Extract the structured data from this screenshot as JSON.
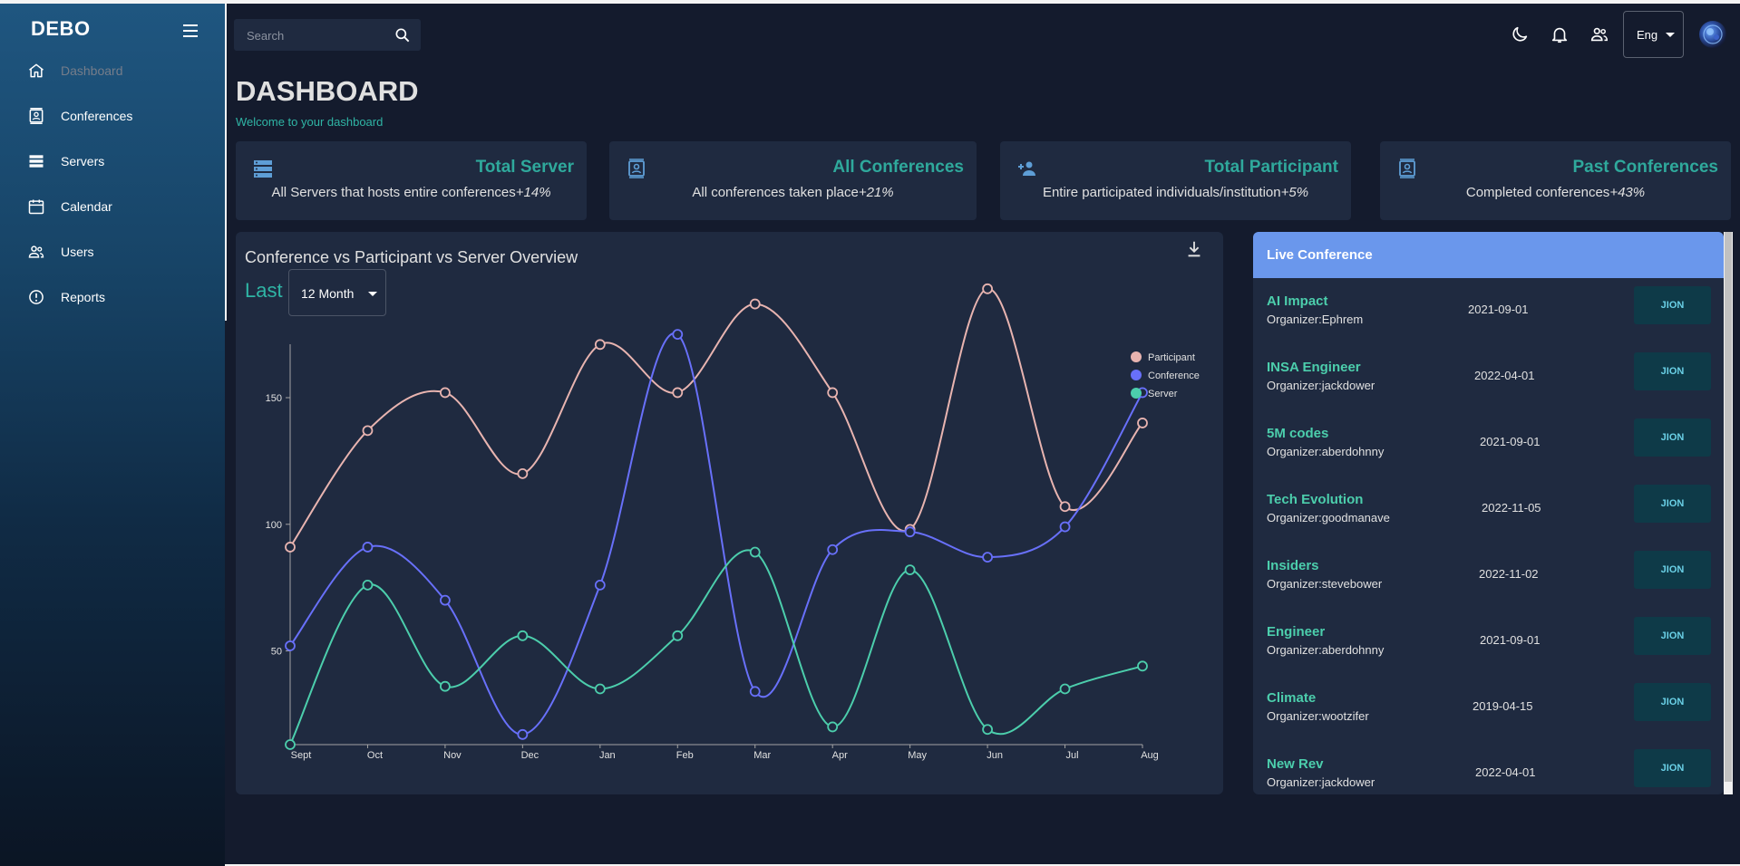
{
  "app": {
    "brand": "DEBO"
  },
  "sidebar": {
    "items": [
      {
        "label": "Dashboard",
        "icon": "home-icon",
        "active": true
      },
      {
        "label": "Conferences",
        "icon": "contact-card-icon",
        "active": false
      },
      {
        "label": "Servers",
        "icon": "server-list-icon",
        "active": false
      },
      {
        "label": "Calendar",
        "icon": "calendar-icon",
        "active": false
      },
      {
        "label": "Users",
        "icon": "users-icon",
        "active": false
      },
      {
        "label": "Reports",
        "icon": "alert-circle-icon",
        "active": false
      }
    ]
  },
  "topbar": {
    "search_placeholder": "Search",
    "language": "Eng"
  },
  "header": {
    "title": "DASHBOARD",
    "subtitle": "Welcome to your dashboard"
  },
  "stats": [
    {
      "title": "Total Server",
      "description": "All Servers that hosts entire conferences",
      "delta": "+14%",
      "icon": "server-icon"
    },
    {
      "title": "All Conferences",
      "description": "All conferences taken place",
      "delta": "+21%",
      "icon": "contact-card-icon"
    },
    {
      "title": "Total Participant",
      "description": "Entire participated individuals/institution",
      "delta": "+5%",
      "icon": "person-add-icon"
    },
    {
      "title": "Past Conferences",
      "description": "Completed conferences",
      "delta": "+43%",
      "icon": "contact-card-icon"
    }
  ],
  "overview": {
    "title": "Conference vs Participant vs Server Overview",
    "last_label": "Last",
    "period": "12 Month"
  },
  "chart_data": {
    "type": "line",
    "title": "",
    "xlabel": "",
    "ylabel": "",
    "categories": [
      "Sept",
      "Oct",
      "Nov",
      "Dec",
      "Jan",
      "Feb",
      "Mar",
      "Apr",
      "May",
      "Jun",
      "Jul",
      "Aug"
    ],
    "ylim": [
      13,
      194
    ],
    "yticks": [
      50,
      100,
      150
    ],
    "grid": false,
    "legend": "top-right",
    "series": [
      {
        "name": "Participant",
        "color": "#e8b4b0",
        "values": [
          91,
          137,
          152,
          120,
          171,
          152,
          187,
          152,
          98,
          193,
          107,
          140
        ]
      },
      {
        "name": "Conference",
        "color": "#6870fa",
        "values": [
          52,
          91,
          70,
          17,
          76,
          175,
          34,
          90,
          97,
          87,
          99,
          152
        ]
      },
      {
        "name": "Server",
        "color": "#4cceac",
        "values": [
          13,
          76,
          36,
          56,
          35,
          56,
          89,
          20,
          82,
          19,
          35,
          44
        ]
      }
    ]
  },
  "live": {
    "title": "Live Conference",
    "join_label": "JION",
    "items": [
      {
        "name": "AI Impact",
        "organizer": "Organizer:Ephrem",
        "date": "2021-09-01"
      },
      {
        "name": "INSA Engineer",
        "organizer": "Organizer:jackdower",
        "date": "2022-04-01"
      },
      {
        "name": "5M codes",
        "organizer": "Organizer:aberdohnny",
        "date": "2021-09-01"
      },
      {
        "name": "Tech Evolution",
        "organizer": "Organizer:goodmanave",
        "date": "2022-11-05"
      },
      {
        "name": "Insiders",
        "organizer": "Organizer:stevebower",
        "date": "2022-11-02"
      },
      {
        "name": "Engineer",
        "organizer": "Organizer:aberdohnny",
        "date": "2021-09-01"
      },
      {
        "name": "Climate",
        "organizer": "Organizer:wootzifer",
        "date": "2019-04-15"
      },
      {
        "name": "New Rev",
        "organizer": "Organizer:jackdower",
        "date": "2022-04-01"
      }
    ]
  }
}
